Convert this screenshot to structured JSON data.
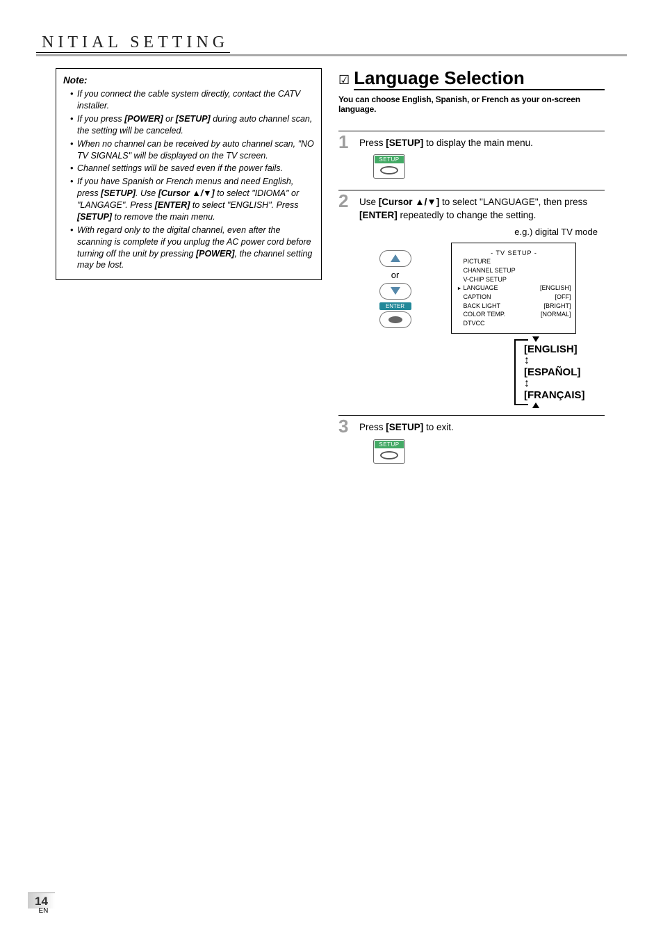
{
  "header": {
    "title": "NITIAL  SETTING"
  },
  "note": {
    "label": "Note:",
    "items": [
      {
        "pre": "If you connect the cable system directly, contact the CATV installer."
      },
      {
        "pre": "If you press ",
        "b1": "[POWER]",
        "mid1": " or ",
        "b2": "[SETUP]",
        "post": " during auto channel scan, the setting will be canceled."
      },
      {
        "pre": "When no channel can be received by auto channel scan, \"NO TV SIGNALS\" will be displayed on the TV screen."
      },
      {
        "pre": "Channel settings will be saved even if the power fails."
      },
      {
        "pre": "If you have Spanish or French menus and need English, press ",
        "b1": "[SETUP]",
        "mid1": ". Use ",
        "b2": "[Cursor ▲/▼]",
        "mid2": " to select \"IDIOMA\" or \"LANGAGE\". Press ",
        "b3": "[ENTER]",
        "mid3": " to select \"ENGLISH\". Press ",
        "b4": "[SETUP]",
        "post": " to remove the main menu."
      },
      {
        "pre": "With regard only to the digital channel, even after the scanning is complete if you unplug the AC power cord before turning off the unit by pressing ",
        "b1": "[POWER]",
        "post": ", the channel setting may be lost."
      }
    ]
  },
  "section": {
    "checkbox": "☑",
    "title": "Language Selection",
    "subtitle": "You can choose English, Spanish, or French as your on-screen language."
  },
  "steps": {
    "s1": {
      "num": "1",
      "t1": "Press ",
      "b1": "[SETUP]",
      "t2": " to display the main menu."
    },
    "s2": {
      "num": "2",
      "t1": "Use ",
      "b1": "[Cursor ▲/▼]",
      "t2": " to select \"LANGUAGE\", then press ",
      "b2": "[ENTER]",
      "t3": " repeatedly to change the setting."
    },
    "s3": {
      "num": "3",
      "t1": "Press ",
      "b1": "[SETUP]",
      "t2": " to exit."
    }
  },
  "remote": {
    "setup_label": "SETUP",
    "or": "or",
    "enter": "ENTER"
  },
  "tv": {
    "eg": "e.g.) digital TV mode",
    "hdr": "-  TV SETUP  -",
    "rows": [
      {
        "l": "PICTURE",
        "r": ""
      },
      {
        "l": "CHANNEL SETUP",
        "r": ""
      },
      {
        "l": "V-CHIP  SETUP",
        "r": ""
      },
      {
        "l": "LANGUAGE",
        "r": "[ENGLISH]",
        "sel": true
      },
      {
        "l": "CAPTION",
        "r": "[OFF]"
      },
      {
        "l": "BACK  LIGHT",
        "r": "[BRIGHT]"
      },
      {
        "l": "COLOR  TEMP.",
        "r": "[NORMAL]"
      },
      {
        "l": "DTVCC",
        "r": ""
      }
    ]
  },
  "langs": {
    "a": "[ENGLISH]",
    "b": "[ESPAÑOL]",
    "c": "[FRANÇAIS]",
    "arrow": "↕"
  },
  "footer": {
    "page": "14",
    "lang": "EN"
  }
}
